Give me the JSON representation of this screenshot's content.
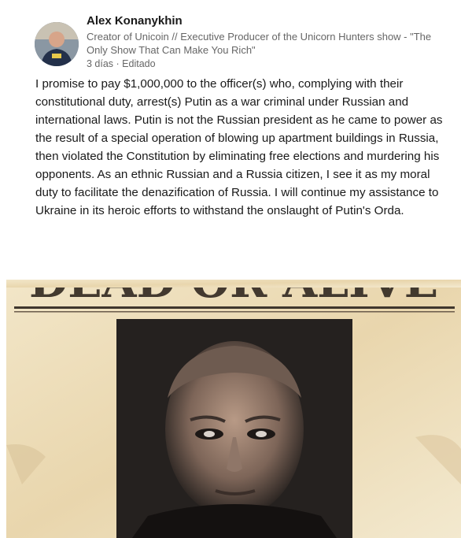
{
  "post": {
    "author_name": "Alex Konanykhin",
    "author_headline": "Creator of Unicoin // Executive Producer of the Unicorn Hunters show - \"The Only Show That Can Make You Rich\"",
    "meta": "3 días · Editado",
    "text": "I promise to pay $1,000,000 to the officer(s) who, complying with their constitutional duty, arrest(s) Putin as a war criminal under Russian and international laws. Putin is not the Russian president as he came to power as the result of a special operation of blowing up apartment buildings in Russia, then violated the Constitution by eliminating free elections and murdering his opponents. As an ethnic Russian and a Russia citizen, I see it as my moral duty to facilitate the denazification of Russia. I will continue my assistance to Ukraine in its heroic efforts to withstand the onslaught of Putin's Orda."
  },
  "poster": {
    "headline": "DEAD OR ALIVE"
  }
}
